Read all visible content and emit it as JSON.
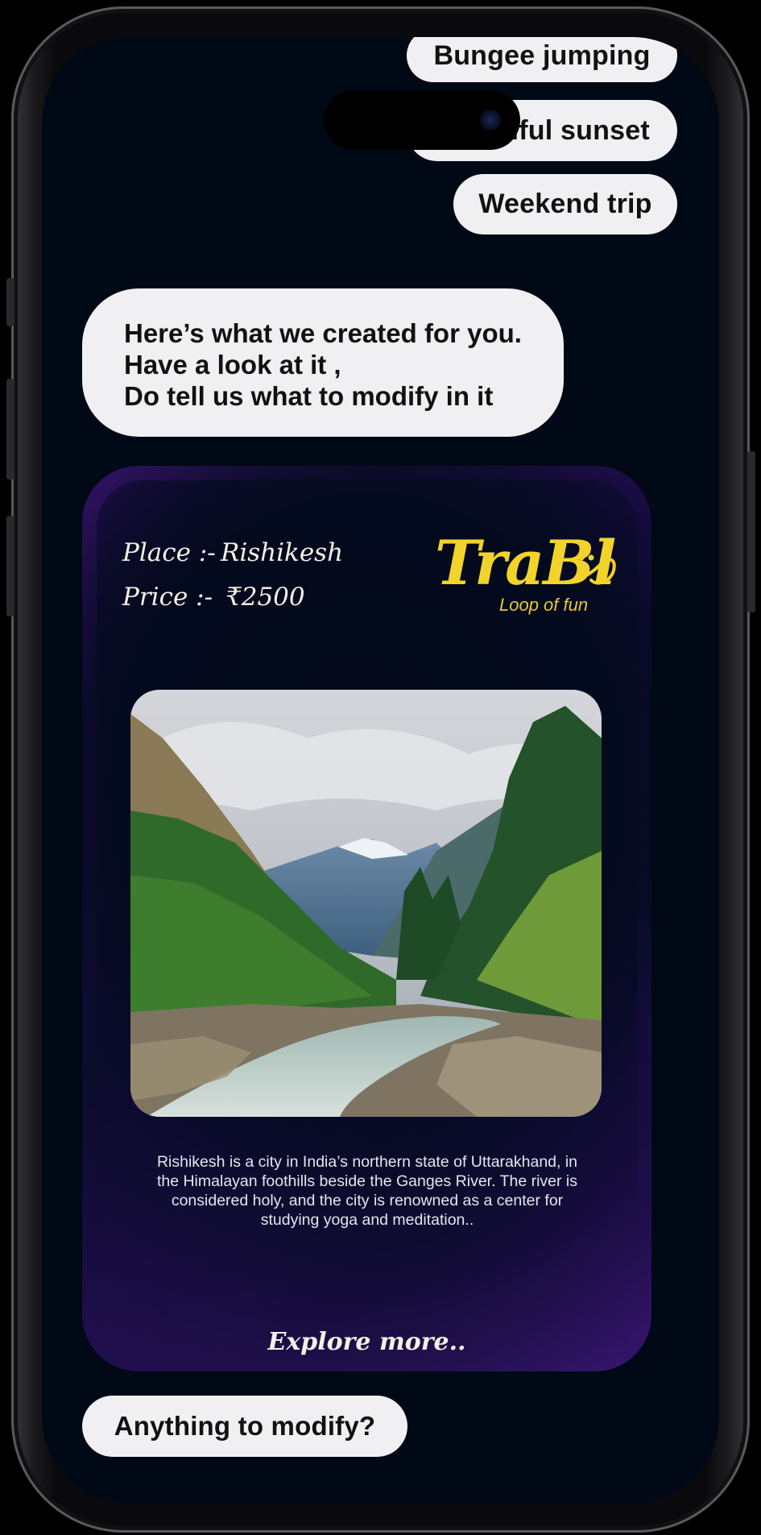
{
  "chips": {
    "bungee": "Bungee jumping",
    "sunset": "Beautiful sunset",
    "weekend": "Weekend trip"
  },
  "bot_message": {
    "line1": "Here’s what we created for you.",
    "line2": "Have a look at it ,",
    "line3": "Do tell us what to modify in it"
  },
  "card": {
    "place_label": "Place :-",
    "place_value": "Rishikesh",
    "price_label": "Price :-",
    "price_value": "₹2500",
    "logo_text": "TraBl",
    "logo_tagline": "Loop of fun",
    "description": "Rishikesh is a city in India’s northern state of Uttarakhand, in the Himalayan foothills beside the Ganges River. The river is considered holy, and the city is renowned as a center for studying yoga and meditation..",
    "explore": "Explore more.."
  },
  "prompt_chip": "Anything to modify?",
  "colors": {
    "screen_bg": "#010816",
    "chip_bg": "#f0f0f2",
    "logo_yellow": "#f2d32a",
    "card_purple": "#3a1470"
  }
}
